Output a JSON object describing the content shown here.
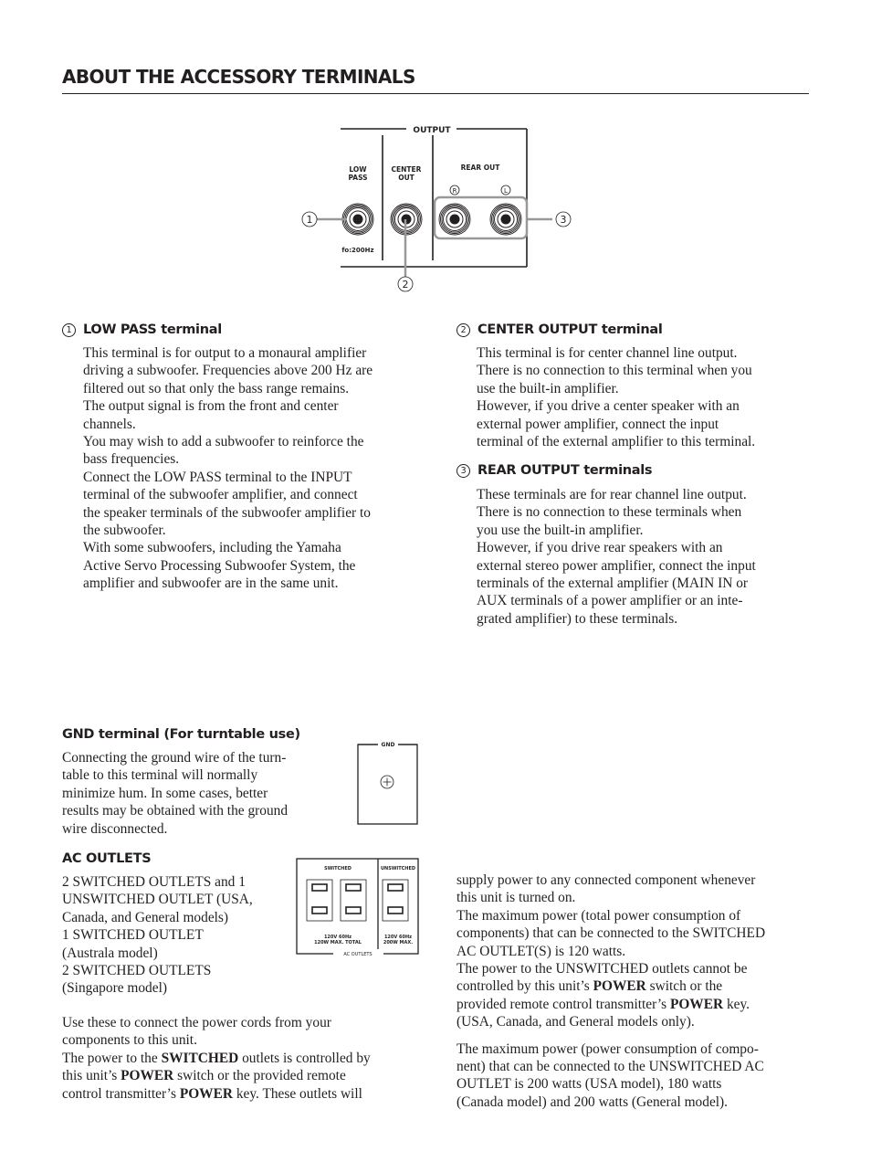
{
  "page": {
    "title": "ABOUT THE ACCESSORY TERMINALS"
  },
  "diagram": {
    "group_label": "OUTPUT",
    "low_pass_label_1": "LOW",
    "low_pass_label_2": "PASS",
    "center_label_1": "CENTER",
    "center_label_2": "OUT",
    "rear_label": "REAR OUT",
    "rear_right": "R",
    "rear_left": "L",
    "cutoff": "fo:200Hz",
    "callouts": [
      "1",
      "2",
      "3"
    ]
  },
  "sections": {
    "low_pass": {
      "num": "1",
      "heading": "LOW PASS terminal",
      "lines": [
        "This terminal is for output to a monaural amplifier",
        "driving a subwoofer. Frequencies above 200 Hz are",
        "filtered out so that only the bass range remains.",
        "The output signal is from the front and center",
        "channels.",
        "You may wish to add a subwoofer to reinforce the",
        "bass frequencies.",
        "Connect the LOW PASS terminal to the INPUT",
        "terminal of the subwoofer amplifier, and connect",
        "the speaker terminals of the subwoofer amplifier to",
        "the subwoofer.",
        "With some subwoofers, including the Yamaha",
        "Active Servo Processing Subwoofer System, the",
        "amplifier and subwoofer are in the same unit."
      ]
    },
    "center": {
      "num": "2",
      "heading": "CENTER OUTPUT terminal",
      "lines": [
        "This terminal is for center channel line output.",
        "There is no connection to this terminal when you",
        "use the built-in amplifier.",
        "However, if you drive a center speaker with an",
        "external power amplifier, connect the input",
        "terminal of the external amplifier to this terminal."
      ]
    },
    "rear": {
      "num": "3",
      "heading": "REAR OUTPUT terminals",
      "lines": [
        "These terminals are for rear channel line output.",
        "There is no connection to these terminals when",
        "you use the built-in amplifier.",
        "However, if you drive rear speakers with an",
        "external stereo power amplifier, connect the input",
        "terminals of the external amplifier (MAIN IN or",
        "AUX terminals of a power amplifier or an inte-",
        "grated amplifier) to these terminals."
      ]
    },
    "gnd": {
      "heading": "GND terminal (For turntable use)",
      "lines": [
        "Connecting the ground wire of the turn-",
        "table to this terminal will normally",
        "minimize hum. In some cases, better",
        "results may be obtained with the ground",
        "wire disconnected."
      ],
      "panel_label": "GND"
    },
    "ac": {
      "heading": "AC OUTLETS",
      "model_lines": [
        "2 SWITCHED OUTLETS and 1",
        "UNSWITCHED OUTLET (USA,",
        "Canada, and General models)",
        "1 SWITCHED OUTLET",
        "(Australa model)",
        "2 SWITCHED OUTLETS",
        "(Singapore model)"
      ],
      "use_1": "Use these to connect the power cords from your",
      "use_2": "components to this unit.",
      "sw_1a": "The power to the ",
      "sw_1b": "SWITCHED",
      "sw_1c": " outlets is controlled by",
      "sw_2a": "this unit’s ",
      "sw_2b": "POWER",
      "sw_2c": " switch or the provided remote",
      "sw_3a": "control transmitter’s ",
      "sw_3b": "POWER",
      "sw_3c": " key. These outlets will",
      "right_lines_1": [
        "supply power to any connected component whenever",
        "this unit is turned on.",
        "The maximum power (total power consumption of",
        "components) that can be connected to the SWITCHED",
        "AC OUTLET(S) is 120 watts.",
        "The power to the UNSWITCHED outlets cannot be"
      ],
      "un_1a": "controlled by this unit’s ",
      "un_1b": "POWER",
      "un_1c": " switch or the",
      "un_2a": "provided remote control transmitter’s ",
      "un_2b": "POWER",
      "un_2c": " key.",
      "un_3": "(USA, Canada, and General models only).",
      "max_lines": [
        "The maximum power (power consumption of compo-",
        "nent) that can be connected to the UNSWITCHED AC",
        "OUTLET is 200 watts (USA model), 180 watts",
        "(Canada model) and 200 watts (General model)."
      ],
      "panel": {
        "switched_label": "SWITCHED",
        "unswitched_label": "UNSWITCHED",
        "switched_rating_1": "120V  60Hz",
        "switched_rating_2": "120W MAX. TOTAL",
        "unswitched_rating_1": "120V  60Hz",
        "unswitched_rating_2": "200W MAX.",
        "group_label": "AC OUTLETS"
      }
    }
  }
}
